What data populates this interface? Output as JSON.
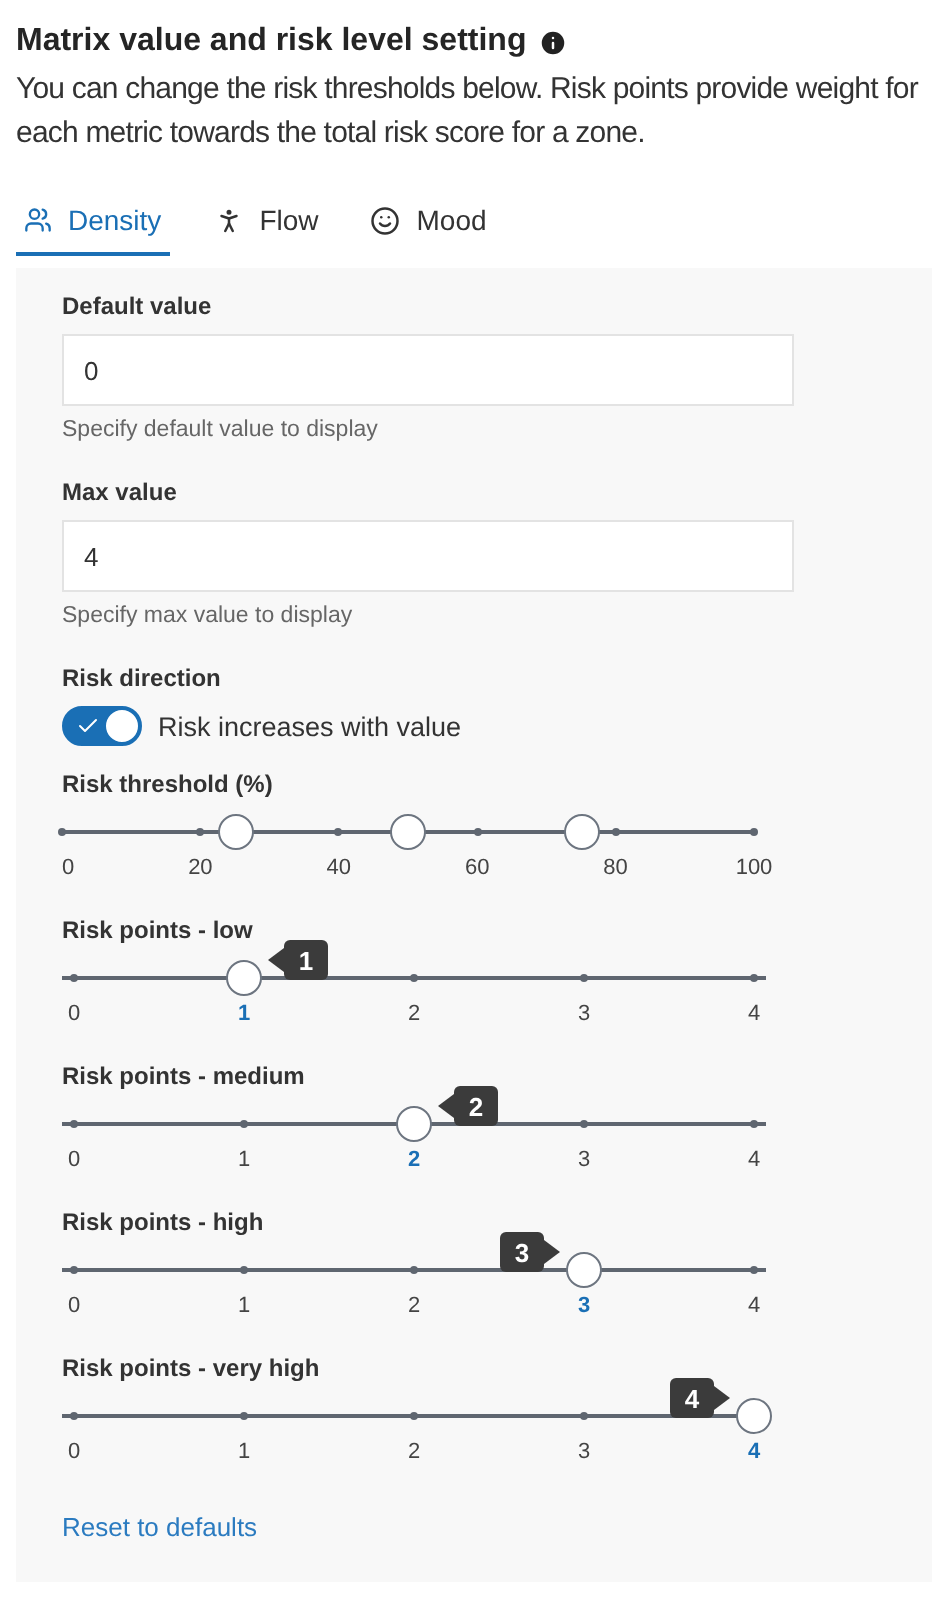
{
  "title": "Matrix value and risk level setting",
  "description": "You can change the risk thresholds below. Risk points provide weight for each metric towards the total risk score for a zone.",
  "tabs": [
    {
      "label": "Density",
      "selected": true
    },
    {
      "label": "Flow",
      "selected": false
    },
    {
      "label": "Mood",
      "selected": false
    }
  ],
  "fields": [
    {
      "label": "Default value",
      "value": "0",
      "helper": "Specify default value to display"
    },
    {
      "label": "Max value",
      "value": "4",
      "helper": "Specify max value to display"
    }
  ],
  "risk_direction": {
    "label": "Risk direction",
    "toggle_label": "Risk increases with value",
    "on": true
  },
  "threshold": {
    "label": "Risk threshold (%)",
    "ticks": [
      "0",
      "20",
      "40",
      "60",
      "80",
      "100"
    ],
    "thumbs": [
      {
        "level": 0.25
      },
      {
        "level": 0.5
      },
      {
        "level": 0.75
      }
    ]
  },
  "risk_points": [
    {
      "label": "Risk points - low",
      "level": 0.25,
      "tooltip": "1",
      "ticks": [
        {
          "label": "0",
          "selected": false
        },
        {
          "label": "1",
          "selected": true
        },
        {
          "label": "2",
          "selected": false
        },
        {
          "label": "3",
          "selected": false
        },
        {
          "label": "4",
          "selected": false
        }
      ]
    },
    {
      "label": "Risk points - medium",
      "level": 0.5,
      "tooltip": "2",
      "ticks": [
        {
          "label": "0",
          "selected": false
        },
        {
          "label": "1",
          "selected": false
        },
        {
          "label": "2",
          "selected": true
        },
        {
          "label": "3",
          "selected": false
        },
        {
          "label": "4",
          "selected": false
        }
      ]
    },
    {
      "label": "Risk points - high",
      "level": 0.75,
      "tooltip": "3",
      "ticks": [
        {
          "label": "0",
          "selected": false
        },
        {
          "label": "1",
          "selected": false
        },
        {
          "label": "2",
          "selected": false
        },
        {
          "label": "3",
          "selected": true
        },
        {
          "label": "4",
          "selected": false
        }
      ]
    },
    {
      "label": "Risk points - very high",
      "level": 1,
      "tooltip": "4",
      "ticks": [
        {
          "label": "0",
          "selected": false
        },
        {
          "label": "1",
          "selected": false
        },
        {
          "label": "2",
          "selected": false
        },
        {
          "label": "3",
          "selected": false
        },
        {
          "label": "4",
          "selected": true
        }
      ]
    }
  ],
  "reset_link": "Reset to defaults"
}
